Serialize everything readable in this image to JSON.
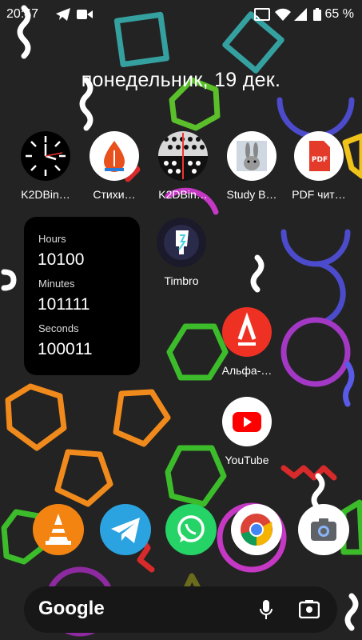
{
  "status_bar": {
    "time": "20:47",
    "battery": "65 %"
  },
  "date": "понедельник, 19 дек.",
  "apps": [
    {
      "label": "K2DBin…",
      "icon": "clock-icon"
    },
    {
      "label": "Стихи…",
      "icon": "stikhi-icon"
    },
    {
      "label": "K2DBin…",
      "icon": "k2dbin-dots-icon"
    },
    {
      "label": "Study B…",
      "icon": "rabbit-icon"
    },
    {
      "label": "PDF чит…",
      "icon": "pdf-icon"
    },
    {
      "label": "Timbro",
      "icon": "timbro-icon"
    },
    {
      "label": "Альфа-…",
      "icon": "alfa-bank-icon"
    },
    {
      "label": "YouTube",
      "icon": "youtube-icon"
    }
  ],
  "widget": {
    "hours_label": "Hours",
    "hours_value": "10100",
    "minutes_label": "Minutes",
    "minutes_value": "101111",
    "seconds_label": "Seconds",
    "seconds_value": "100011"
  },
  "dock": [
    {
      "icon": "vlc-icon"
    },
    {
      "icon": "telegram-icon"
    },
    {
      "icon": "whatsapp-icon"
    },
    {
      "icon": "chrome-icon"
    },
    {
      "icon": "camera-icon"
    }
  ],
  "search": {
    "logo": "Google"
  },
  "colors": {
    "widget_bg": "#000000",
    "wallpaper_bg": "#232323"
  }
}
